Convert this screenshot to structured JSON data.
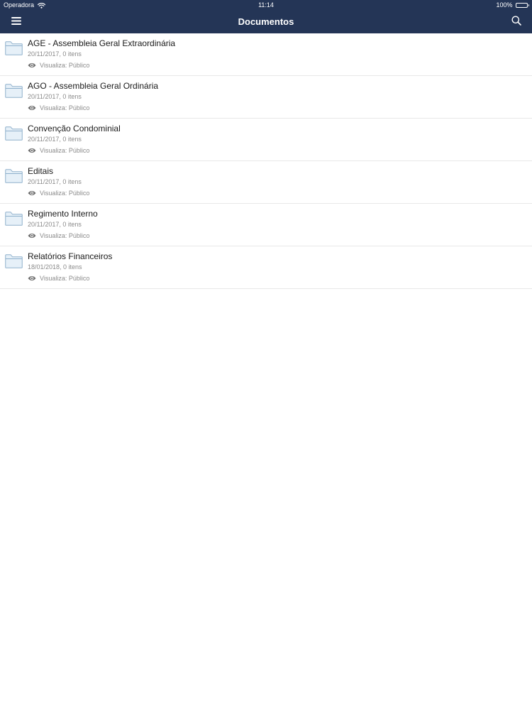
{
  "status_bar": {
    "carrier": "Operadora",
    "time": "11:14",
    "battery": "100%"
  },
  "navbar": {
    "title": "Documentos",
    "menu_icon": "hamburger-menu-icon",
    "search_icon": "search-icon"
  },
  "colors": {
    "header_bg": "#243556",
    "folder_fill": "#e6f0f8",
    "folder_stroke": "#8fb0cc"
  },
  "documents": [
    {
      "title": "AGE - Assembleia Geral Extraordinária",
      "meta": "20/11/2017, 0 itens",
      "visibility": "Visualiza: Público"
    },
    {
      "title": "AGO - Assembleia Geral Ordinária",
      "meta": "20/11/2017, 0 itens",
      "visibility": "Visualiza: Público"
    },
    {
      "title": "Convenção Condominial",
      "meta": "20/11/2017, 0 itens",
      "visibility": "Visualiza: Público"
    },
    {
      "title": "Editais",
      "meta": "20/11/2017, 0 itens",
      "visibility": "Visualiza: Público"
    },
    {
      "title": "Regimento Interno",
      "meta": "20/11/2017, 0 itens",
      "visibility": "Visualiza: Público"
    },
    {
      "title": "Relatórios Financeiros",
      "meta": "18/01/2018, 0 itens",
      "visibility": "Visualiza: Público"
    }
  ]
}
